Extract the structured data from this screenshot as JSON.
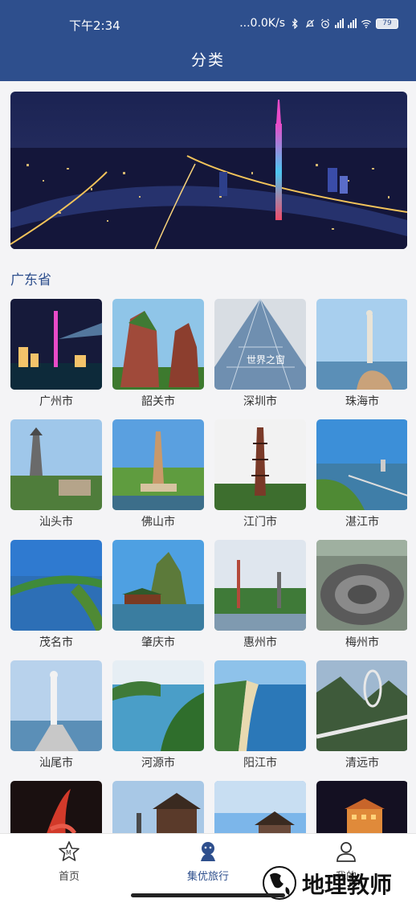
{
  "status_bar": {
    "time": "下午2:34",
    "network_speed": "...0.0K/s",
    "battery": "79"
  },
  "header": {
    "title": "分类"
  },
  "section": {
    "title": "广东省"
  },
  "cities": [
    "广州市",
    "韶关市",
    "深圳市",
    "珠海市",
    "汕头市",
    "佛山市",
    "江门市",
    "湛江市",
    "茂名市",
    "肇庆市",
    "惠州市",
    "梅州市",
    "汕尾市",
    "河源市",
    "阳江市",
    "清远市",
    "",
    "",
    "",
    ""
  ],
  "bottom_nav": [
    {
      "label": "首页",
      "icon": "star-badge-icon",
      "active": false
    },
    {
      "label": "集优旅行",
      "icon": "travel-mascot-icon",
      "active": true
    },
    {
      "label": "我的",
      "icon": "user-icon",
      "active": false
    }
  ],
  "watermark": {
    "text": "地理教师"
  },
  "colors": {
    "primary": "#2e4f8d",
    "background": "#f4f4f6"
  }
}
